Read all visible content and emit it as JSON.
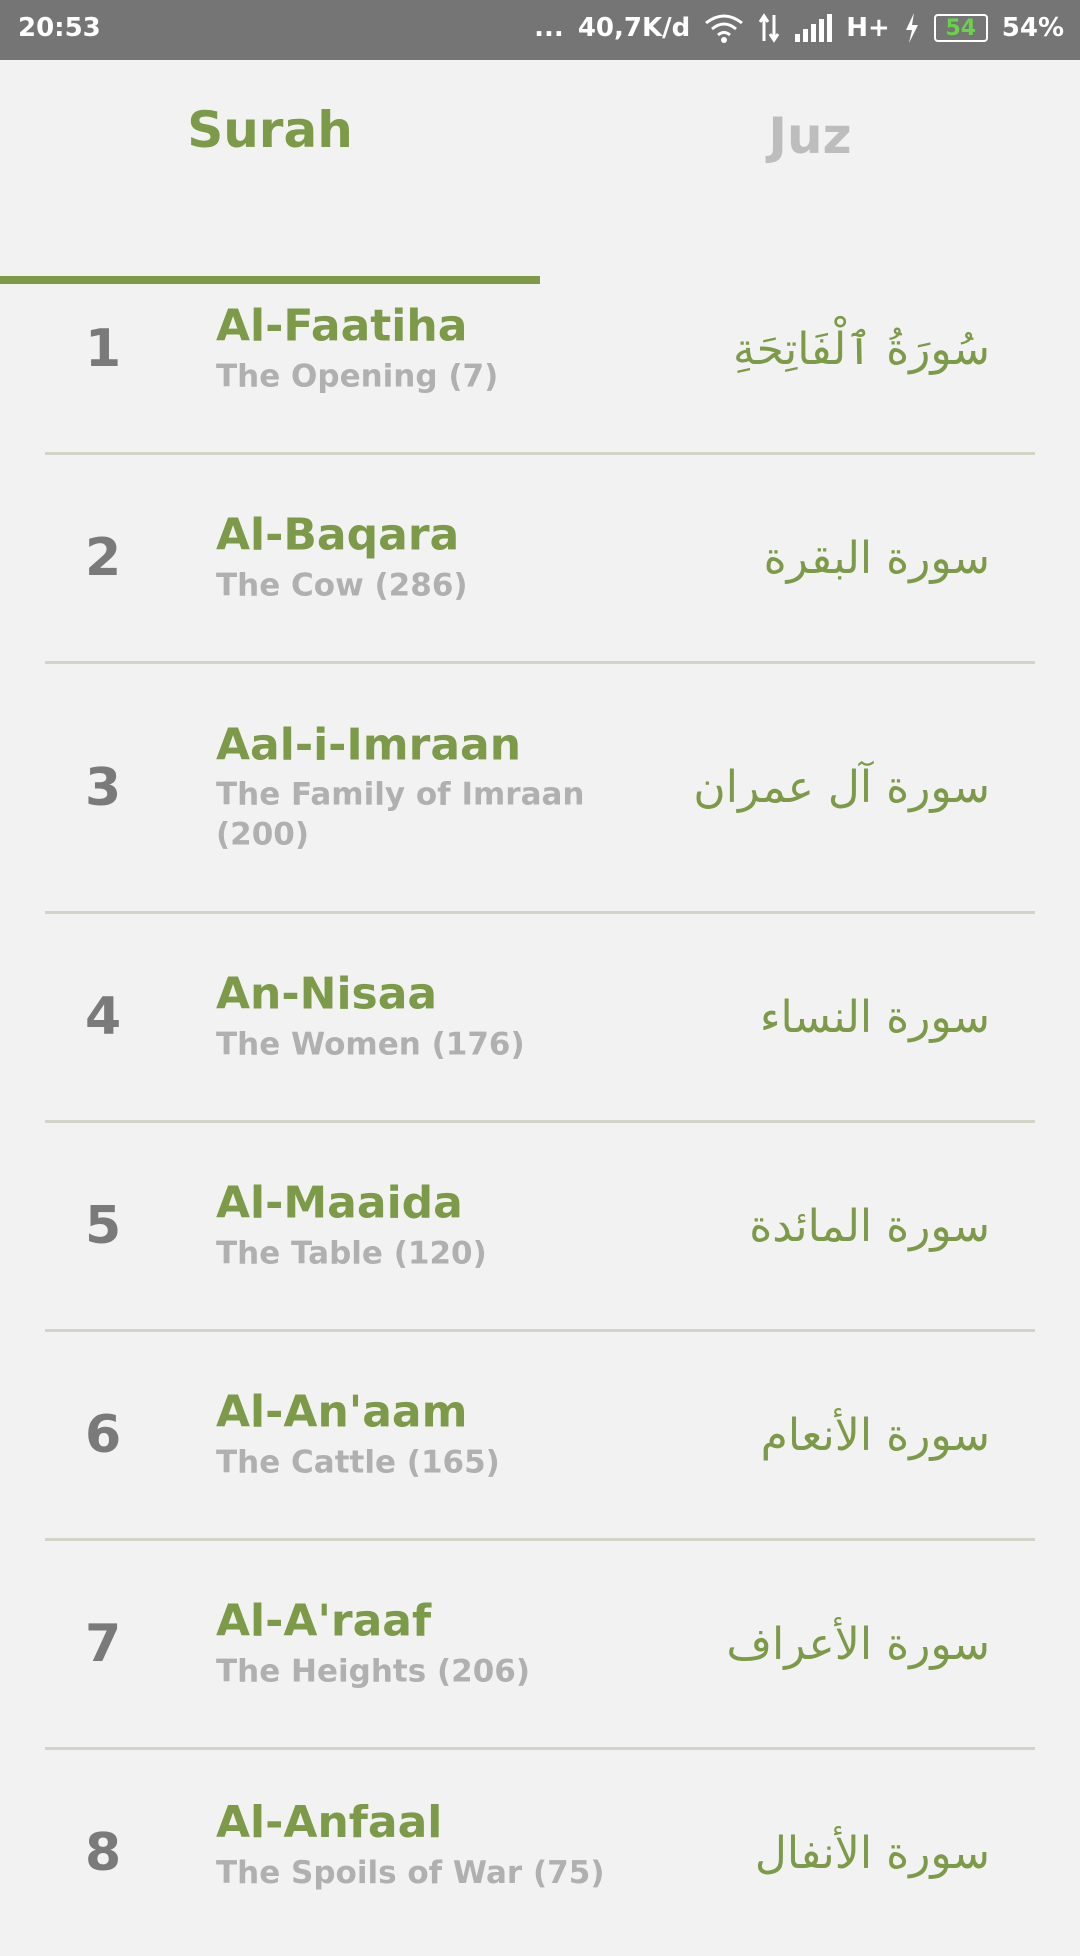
{
  "status_bar": {
    "time": "20:53",
    "dots": "...",
    "speed": "40,7K/d",
    "network": "H+",
    "battery_level": "54",
    "battery_percent": "54%"
  },
  "tabs": [
    {
      "label": "Surah",
      "selected": true
    },
    {
      "label": "Juz",
      "selected": false
    }
  ],
  "colors": {
    "accent": "#7c9a48",
    "inactive_tab": "#bdbdbd",
    "number": "#7a7a7a",
    "subtitle": "#b0b0b0",
    "divider": "#d2d4c8",
    "status_bar": "#757575"
  },
  "surahs": [
    {
      "number": "1",
      "name": "Al-Faatiha",
      "translation": "The Opening (7)",
      "arabic": "سُورَةُ ٱلْفَاتِحَةِ"
    },
    {
      "number": "2",
      "name": "Al-Baqara",
      "translation": "The Cow (286)",
      "arabic": "سورة البقرة"
    },
    {
      "number": "3",
      "name": "Aal-i-Imraan",
      "translation": "The Family of Imraan (200)",
      "arabic": "سورة آل عمران"
    },
    {
      "number": "4",
      "name": "An-Nisaa",
      "translation": "The Women (176)",
      "arabic": "سورة النساء"
    },
    {
      "number": "5",
      "name": "Al-Maaida",
      "translation": "The Table (120)",
      "arabic": "سورة المائدة"
    },
    {
      "number": "6",
      "name": "Al-An'aam",
      "translation": "The Cattle (165)",
      "arabic": "سورة الأنعام"
    },
    {
      "number": "7",
      "name": "Al-A'raaf",
      "translation": "The Heights (206)",
      "arabic": "سورة الأعراف"
    },
    {
      "number": "8",
      "name": "Al-Anfaal",
      "translation": "The Spoils of War (75)",
      "arabic": "سورة الأنفال"
    }
  ]
}
